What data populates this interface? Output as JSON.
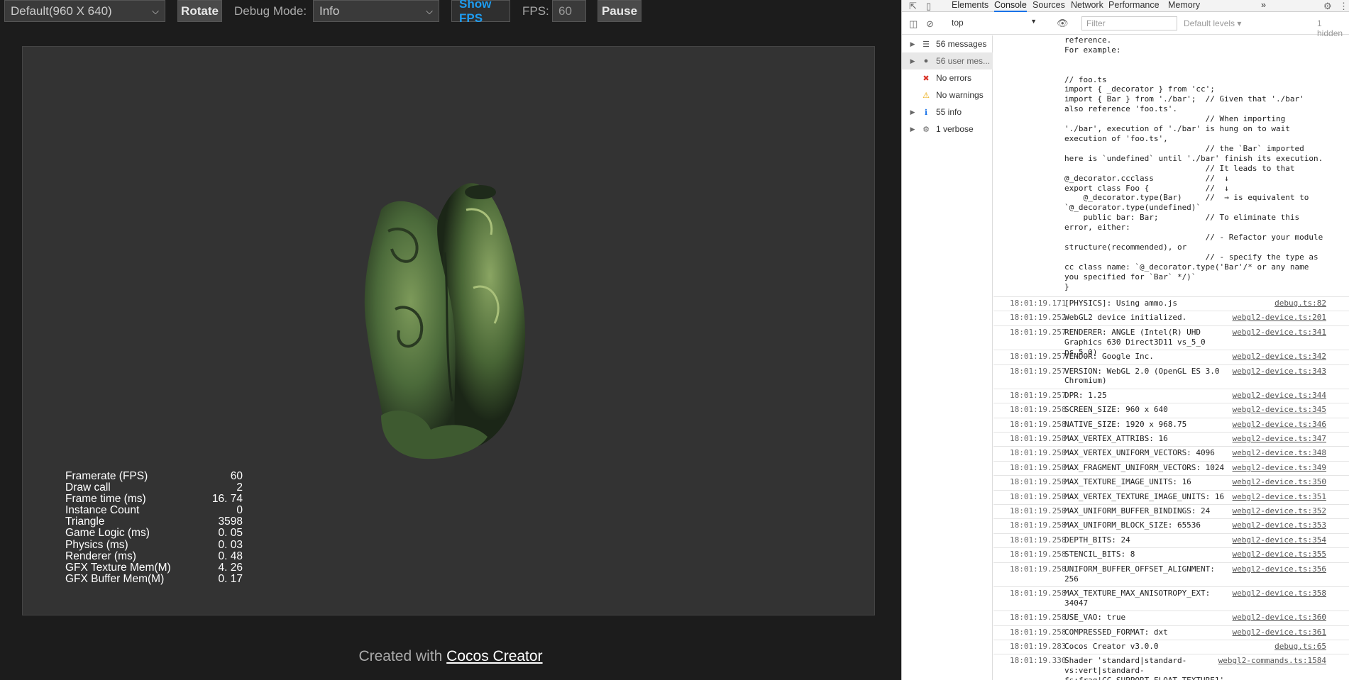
{
  "toolbar": {
    "resolution": "Default(960 X 640)",
    "rotate": "Rotate",
    "debug_mode_label": "Debug Mode:",
    "debug_mode_value": "Info",
    "show_fps": "Show FPS",
    "fps_label": "FPS:",
    "fps_value": "60",
    "pause": "Pause"
  },
  "stats": [
    {
      "label": "Framerate (FPS)",
      "value": "60"
    },
    {
      "label": "Draw call",
      "value": "2"
    },
    {
      "label": "Frame time (ms)",
      "value": "16. 74"
    },
    {
      "label": "Instance Count",
      "value": "0"
    },
    {
      "label": "Triangle",
      "value": "3598"
    },
    {
      "label": "Game Logic (ms)",
      "value": "0. 05"
    },
    {
      "label": "Physics (ms)",
      "value": "0. 03"
    },
    {
      "label": "Renderer (ms)",
      "value": "0. 48"
    },
    {
      "label": "GFX Texture Mem(M)",
      "value": "4. 26"
    },
    {
      "label": "GFX Buffer Mem(M)",
      "value": "0. 17"
    }
  ],
  "footer": {
    "prefix": "Created with ",
    "link": "Cocos Creator"
  },
  "devtools": {
    "tabs": [
      "Elements",
      "Console",
      "Sources",
      "Network",
      "Performance",
      "Memory"
    ],
    "active_tab": "Console",
    "more_tabs": "»",
    "context": "top",
    "filter_placeholder": "Filter",
    "levels": "Default levels ▾",
    "hidden": "1 hidden",
    "sidebar": [
      {
        "label": "56 messages",
        "icon": "list-icon"
      },
      {
        "label": "56 user mes...",
        "icon": "user-icon"
      },
      {
        "label": "No errors",
        "icon": "error-icon"
      },
      {
        "label": "No warnings",
        "icon": "warning-icon"
      },
      {
        "label": "55 info",
        "icon": "info-icon"
      },
      {
        "label": "1 verbose",
        "icon": "verbose-icon"
      }
    ],
    "code_block": "is that instance of foo, this may indicate a circular\nreference.\nFor example:\n\n\n// foo.ts\nimport { _decorator } from 'cc';\nimport { Bar } from './bar';  // Given that './bar'\nalso reference 'foo.ts'.\n                              // When importing\n'./bar', execution of './bar' is hung on to wait\nexecution of 'foo.ts',\n                              // the `Bar` imported\nhere is `undefined` until './bar' finish its execution.\n                              // It leads to that\n@_decorator.ccclass           //  ↓\nexport class Foo {            //  ↓\n    @_decorator.type(Bar)     //  → is equivalent to\n`@_decorator.type(undefined)`\n    public bar: Bar;          // To eliminate this\nerror, either:\n                              // - Refactor your module\nstructure(recommended), or\n                              // - specify the type as\ncc class name: `@_decorator.type('Bar'/* or any name\nyou specified for `Bar` */)`\n}",
    "logs": [
      {
        "ts": "18:01:19.171",
        "msg": "[PHYSICS]: Using ammo.js",
        "src": "debug.ts:82",
        "lines": 1
      },
      {
        "ts": "18:01:19.252",
        "msg": "WebGL2 device initialized.",
        "src": "webgl2-device.ts:201",
        "lines": 1
      },
      {
        "ts": "18:01:19.257",
        "msg": "RENDERER: ANGLE (Intel(R) UHD\nGraphics 630 Direct3D11 vs_5_0 ps_5_0)",
        "src": "webgl2-device.ts:341",
        "lines": 2
      },
      {
        "ts": "18:01:19.257",
        "msg": "VENDOR: Google Inc.",
        "src": "webgl2-device.ts:342",
        "lines": 1
      },
      {
        "ts": "18:01:19.257",
        "msg": "VERSION: WebGL 2.0 (OpenGL ES 3.0\nChromium)",
        "src": "webgl2-device.ts:343",
        "lines": 2
      },
      {
        "ts": "18:01:19.257",
        "msg": "DPR: 1.25",
        "src": "webgl2-device.ts:344",
        "lines": 1
      },
      {
        "ts": "18:01:19.258",
        "msg": "SCREEN_SIZE: 960 x 640",
        "src": "webgl2-device.ts:345",
        "lines": 1
      },
      {
        "ts": "18:01:19.258",
        "msg": "NATIVE_SIZE: 1920 x 968.75",
        "src": "webgl2-device.ts:346",
        "lines": 1
      },
      {
        "ts": "18:01:19.258",
        "msg": "MAX_VERTEX_ATTRIBS: 16",
        "src": "webgl2-device.ts:347",
        "lines": 1
      },
      {
        "ts": "18:01:19.258",
        "msg": "MAX_VERTEX_UNIFORM_VECTORS: 4096",
        "src": "webgl2-device.ts:348",
        "lines": 1
      },
      {
        "ts": "18:01:19.258",
        "msg": "MAX_FRAGMENT_UNIFORM_VECTORS: 1024",
        "src": "webgl2-device.ts:349",
        "lines": 1
      },
      {
        "ts": "18:01:19.258",
        "msg": "MAX_TEXTURE_IMAGE_UNITS: 16",
        "src": "webgl2-device.ts:350",
        "lines": 1
      },
      {
        "ts": "18:01:19.258",
        "msg": "MAX_VERTEX_TEXTURE_IMAGE_UNITS: 16",
        "src": "webgl2-device.ts:351",
        "lines": 1
      },
      {
        "ts": "18:01:19.258",
        "msg": "MAX_UNIFORM_BUFFER_BINDINGS: 24",
        "src": "webgl2-device.ts:352",
        "lines": 1
      },
      {
        "ts": "18:01:19.258",
        "msg": "MAX_UNIFORM_BLOCK_SIZE: 65536",
        "src": "webgl2-device.ts:353",
        "lines": 1
      },
      {
        "ts": "18:01:19.258",
        "msg": "DEPTH_BITS: 24",
        "src": "webgl2-device.ts:354",
        "lines": 1
      },
      {
        "ts": "18:01:19.258",
        "msg": "STENCIL_BITS: 8",
        "src": "webgl2-device.ts:355",
        "lines": 1
      },
      {
        "ts": "18:01:19.258",
        "msg": "UNIFORM_BUFFER_OFFSET_ALIGNMENT:\n256",
        "src": "webgl2-device.ts:356",
        "lines": 2
      },
      {
        "ts": "18:01:19.258",
        "msg": "MAX_TEXTURE_MAX_ANISOTROPY_EXT:\n34047",
        "src": "webgl2-device.ts:358",
        "lines": 2
      },
      {
        "ts": "18:01:19.258",
        "msg": "USE_VAO: true",
        "src": "webgl2-device.ts:360",
        "lines": 1
      },
      {
        "ts": "18:01:19.258",
        "msg": "COMPRESSED_FORMAT: dxt",
        "src": "webgl2-device.ts:361",
        "lines": 1
      },
      {
        "ts": "18:01:19.283",
        "msg": "Cocos Creator v3.0.0",
        "src": "debug.ts:65",
        "lines": 1
      },
      {
        "ts": "18:01:19.330",
        "msg": "Shader 'standard|standard-\nvs:vert|standard-fs:frag|CC_SUPPORT_FLOAT_TEXTURE1'\ncompilation succeeded.",
        "src": "webgl2-commands.ts:1584",
        "lines": 3
      }
    ]
  }
}
